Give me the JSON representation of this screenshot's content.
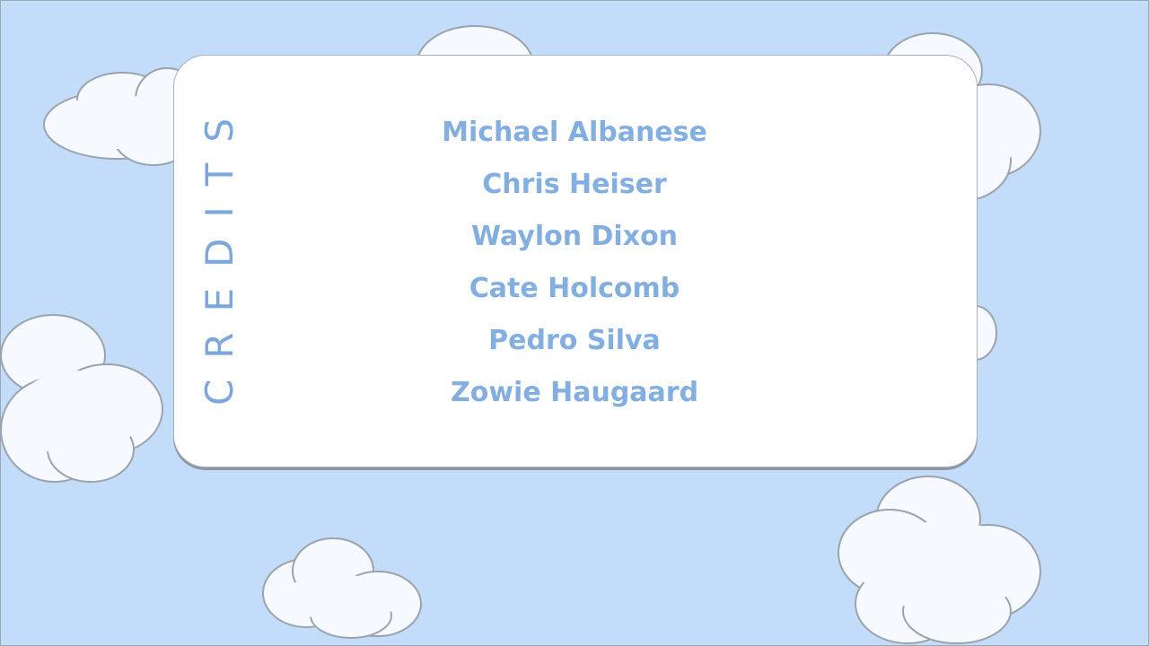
{
  "slide": {
    "title": "CREDITS",
    "names": [
      "Michael Albanese",
      "Chris Heiser",
      "Waylon Dixon",
      "Cate Holcomb",
      "Pedro Silva",
      "Zowie Haugaard"
    ]
  },
  "colors": {
    "sky": "#c2dcfa",
    "card": "#ffffff",
    "text": "#83aee0",
    "cloud_fill": "#f6f9fd",
    "cloud_stroke": "#9ba3ac"
  }
}
